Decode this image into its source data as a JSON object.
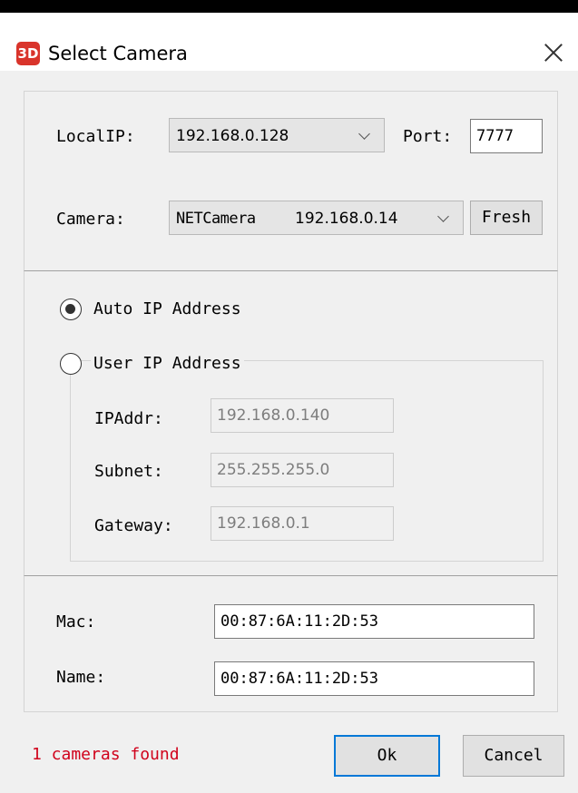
{
  "window": {
    "title": "Select Camera",
    "app_icon_text": "3D"
  },
  "connection": {
    "localip_label": "LocalIP:",
    "localip_value": "192.168.0.128",
    "port_label": "Port:",
    "port_value": "7777",
    "camera_label": "Camera:",
    "camera_name": "NETCamera",
    "camera_ip": "192.168.0.14",
    "fresh_label": "Fresh"
  },
  "ip_mode": {
    "auto_label": "Auto IP Address",
    "auto_selected": true,
    "user_label": "User IP Address",
    "user_selected": false,
    "ipaddr_label": "IPAddr:",
    "ipaddr_value": "192.168.0.140",
    "subnet_label": "Subnet:",
    "subnet_value": "255.255.255.0",
    "gateway_label": "Gateway:",
    "gateway_value": "192.168.0.1"
  },
  "device": {
    "mac_label": "Mac:",
    "mac_value": "00:87:6A:11:2D:53",
    "name_label": "Name:",
    "name_value": "00:87:6A:11:2D:53"
  },
  "footer": {
    "status": "1 cameras found",
    "ok_label": "Ok",
    "cancel_label": "Cancel"
  },
  "colors": {
    "status_text": "#d0021b",
    "default_button_border": "#0078d7",
    "app_icon": "#d9342b"
  }
}
